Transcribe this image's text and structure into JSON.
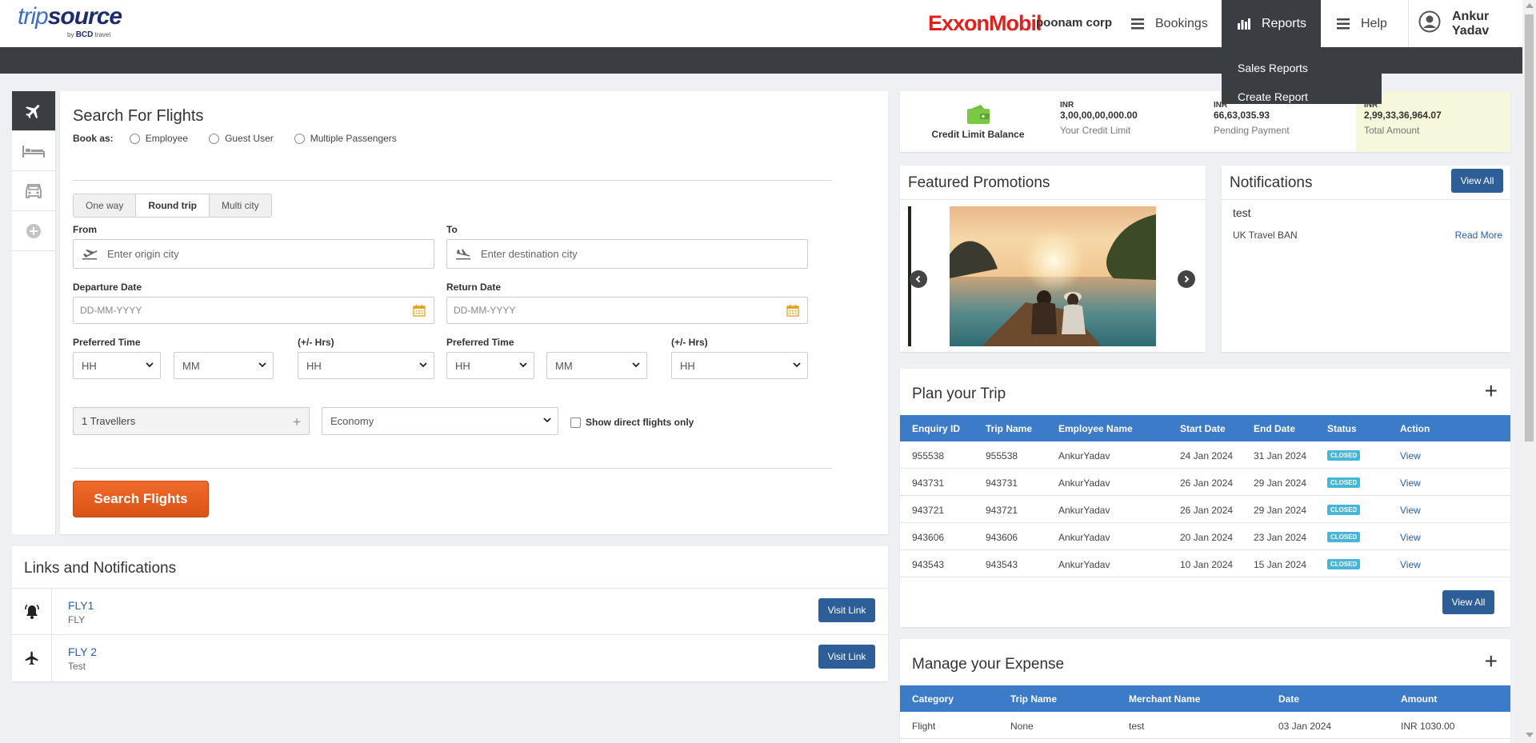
{
  "header": {
    "logo_main_1": "trip",
    "logo_main_2": "source",
    "logo_by": "by",
    "logo_bcd": "BCD",
    "logo_travel": "travel",
    "brand": "ExxonMobil",
    "company": "poonam corp",
    "nav": {
      "bookings": "Bookings",
      "reports": "Reports",
      "help": "Help",
      "user": "Ankur Yadav"
    },
    "reports_menu": [
      "Sales Reports",
      "Create Report"
    ]
  },
  "search": {
    "title": "Search For Flights",
    "book_as_label": "Book as:",
    "book_as_options": [
      "Employee",
      "Guest User",
      "Multiple Passengers"
    ],
    "trip_types": [
      "One way",
      "Round trip",
      "Multi city"
    ],
    "selected_trip_type": "Round trip",
    "from_label": "From",
    "from_placeholder": "Enter origin city",
    "to_label": "To",
    "to_placeholder": "Enter destination city",
    "departure_label": "Departure Date",
    "departure_placeholder": "DD-MM-YYYY",
    "return_label": "Return Date",
    "return_placeholder": "DD-MM-YYYY",
    "pref_time_label": "Preferred Time",
    "plusminus_label": "(+/- Hrs)",
    "hh": "HH",
    "mm": "MM",
    "travellers": "1 Travellers",
    "cabin": "Economy",
    "direct_label": "Show direct flights only",
    "search_button": "Search Flights"
  },
  "links": {
    "title": "Links and Notifications",
    "items": [
      {
        "name": "FLY1",
        "sub": "FLY",
        "button": "Visit Link"
      },
      {
        "name": "FLY 2",
        "sub": "Test",
        "button": "Visit Link"
      }
    ]
  },
  "credit": {
    "label": "Credit Limit Balance",
    "items": [
      {
        "currency": "INR",
        "value": "3,00,00,00,000.00",
        "label": "Your Credit Limit"
      },
      {
        "currency": "INR",
        "value": "66,63,035.93",
        "label": "Pending Payment"
      },
      {
        "currency": "INR",
        "value": "2,99,33,36,964.07",
        "label": "Total Amount"
      }
    ]
  },
  "promotions": {
    "title": "Featured Promotions"
  },
  "notifications": {
    "title": "Notifications",
    "view_all": "View All",
    "item_title": "test",
    "item_sub": "UK Travel BAN",
    "read_more": "Read More"
  },
  "plan": {
    "title": "Plan your Trip",
    "columns": [
      "Enquiry ID",
      "Trip Name",
      "Employee Name",
      "Start Date",
      "End Date",
      "Status",
      "Action"
    ],
    "rows": [
      [
        "955538",
        "955538",
        "AnkurYadav",
        "24 Jan 2024",
        "31 Jan 2024",
        "CLOSED",
        "View"
      ],
      [
        "943731",
        "943731",
        "AnkurYadav",
        "26 Jan 2024",
        "29 Jan 2024",
        "CLOSED",
        "View"
      ],
      [
        "943721",
        "943721",
        "AnkurYadav",
        "26 Jan 2024",
        "29 Jan 2024",
        "CLOSED",
        "View"
      ],
      [
        "943606",
        "943606",
        "AnkurYadav",
        "20 Jan 2024",
        "23 Jan 2024",
        "CLOSED",
        "View"
      ],
      [
        "943543",
        "943543",
        "AnkurYadav",
        "10 Jan 2024",
        "15 Jan 2024",
        "CLOSED",
        "View"
      ]
    ],
    "view_all": "View All"
  },
  "expense": {
    "title": "Manage your Expense",
    "columns": [
      "Category",
      "Trip Name",
      "Merchant Name",
      "Date",
      "Amount"
    ],
    "rows": [
      [
        "Flight",
        "None",
        "test",
        "03 Jan 2024",
        "INR 1030.00"
      ]
    ]
  }
}
